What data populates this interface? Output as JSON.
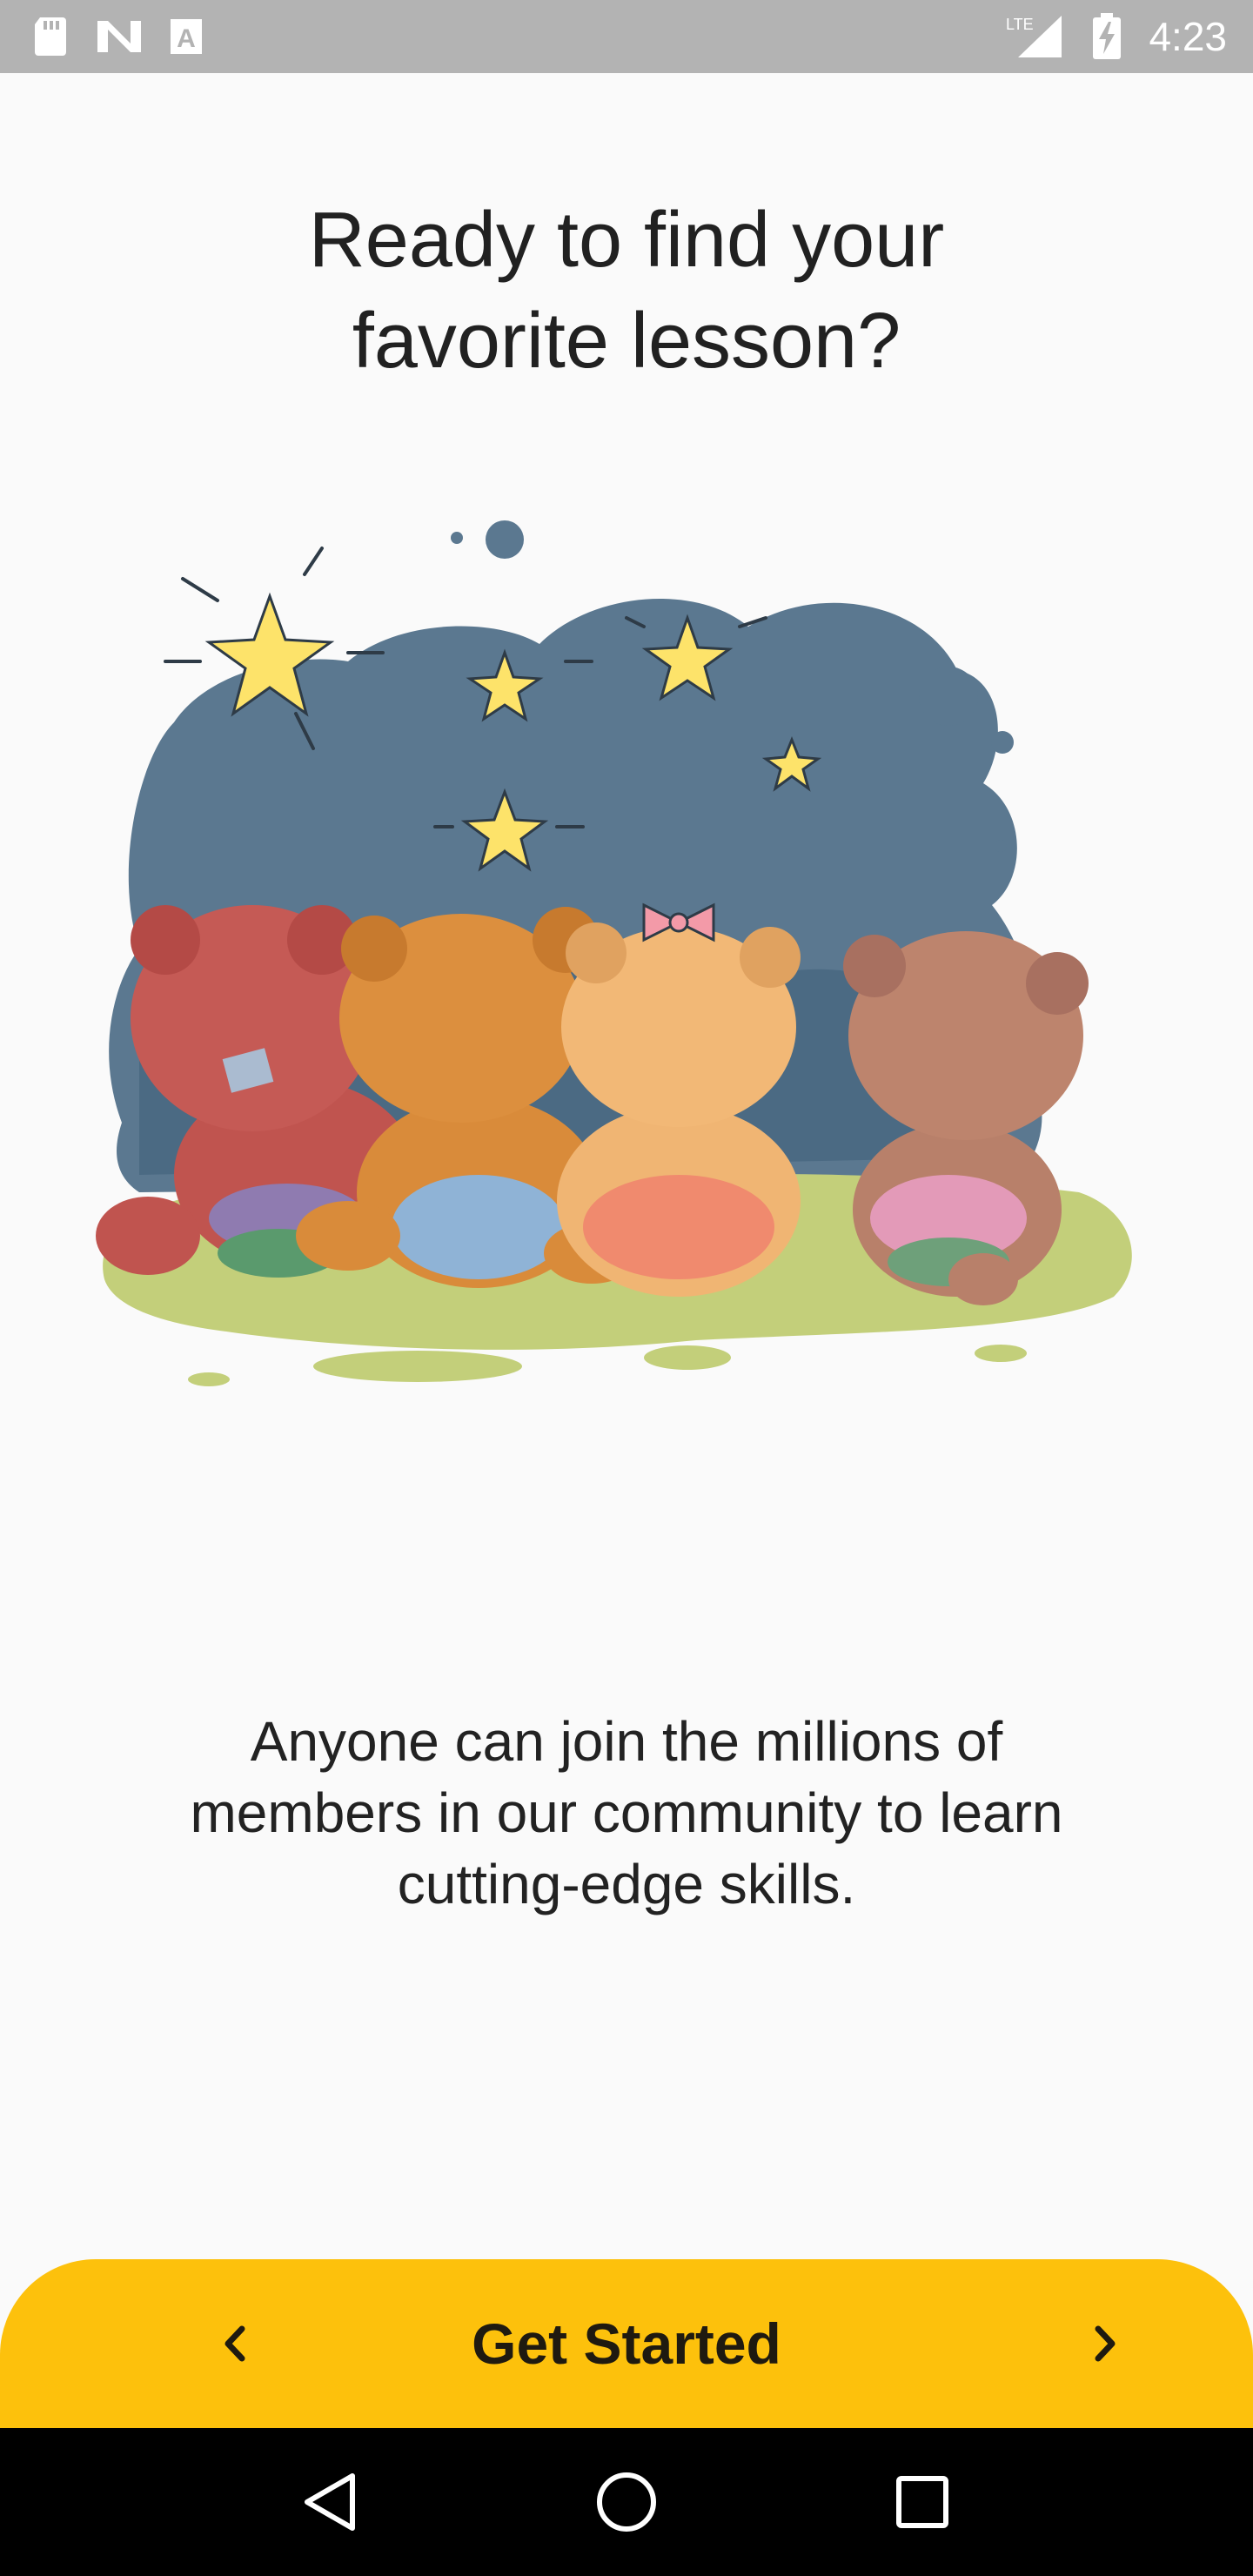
{
  "status_bar": {
    "time": "4:23",
    "network": "LTE",
    "icons": [
      "sd-card-icon",
      "n-icon",
      "a-icon",
      "signal-icon",
      "battery-charging-icon"
    ]
  },
  "onboarding": {
    "headline_line1": "Ready to find your",
    "headline_line2": "favorite lesson?",
    "illustration": "teddy-bears-stargazing-illustration",
    "description_line1": "Anyone can join the millions of",
    "description_line2": "members in our community to learn",
    "description_line3": "cutting-edge skills."
  },
  "cta": {
    "label": "Get Started",
    "prev_icon": "chevron-left-icon",
    "next_icon": "chevron-right-icon",
    "color": "#fdc10c"
  },
  "system_nav": {
    "icons": [
      "back-icon",
      "home-icon",
      "recents-icon"
    ]
  }
}
